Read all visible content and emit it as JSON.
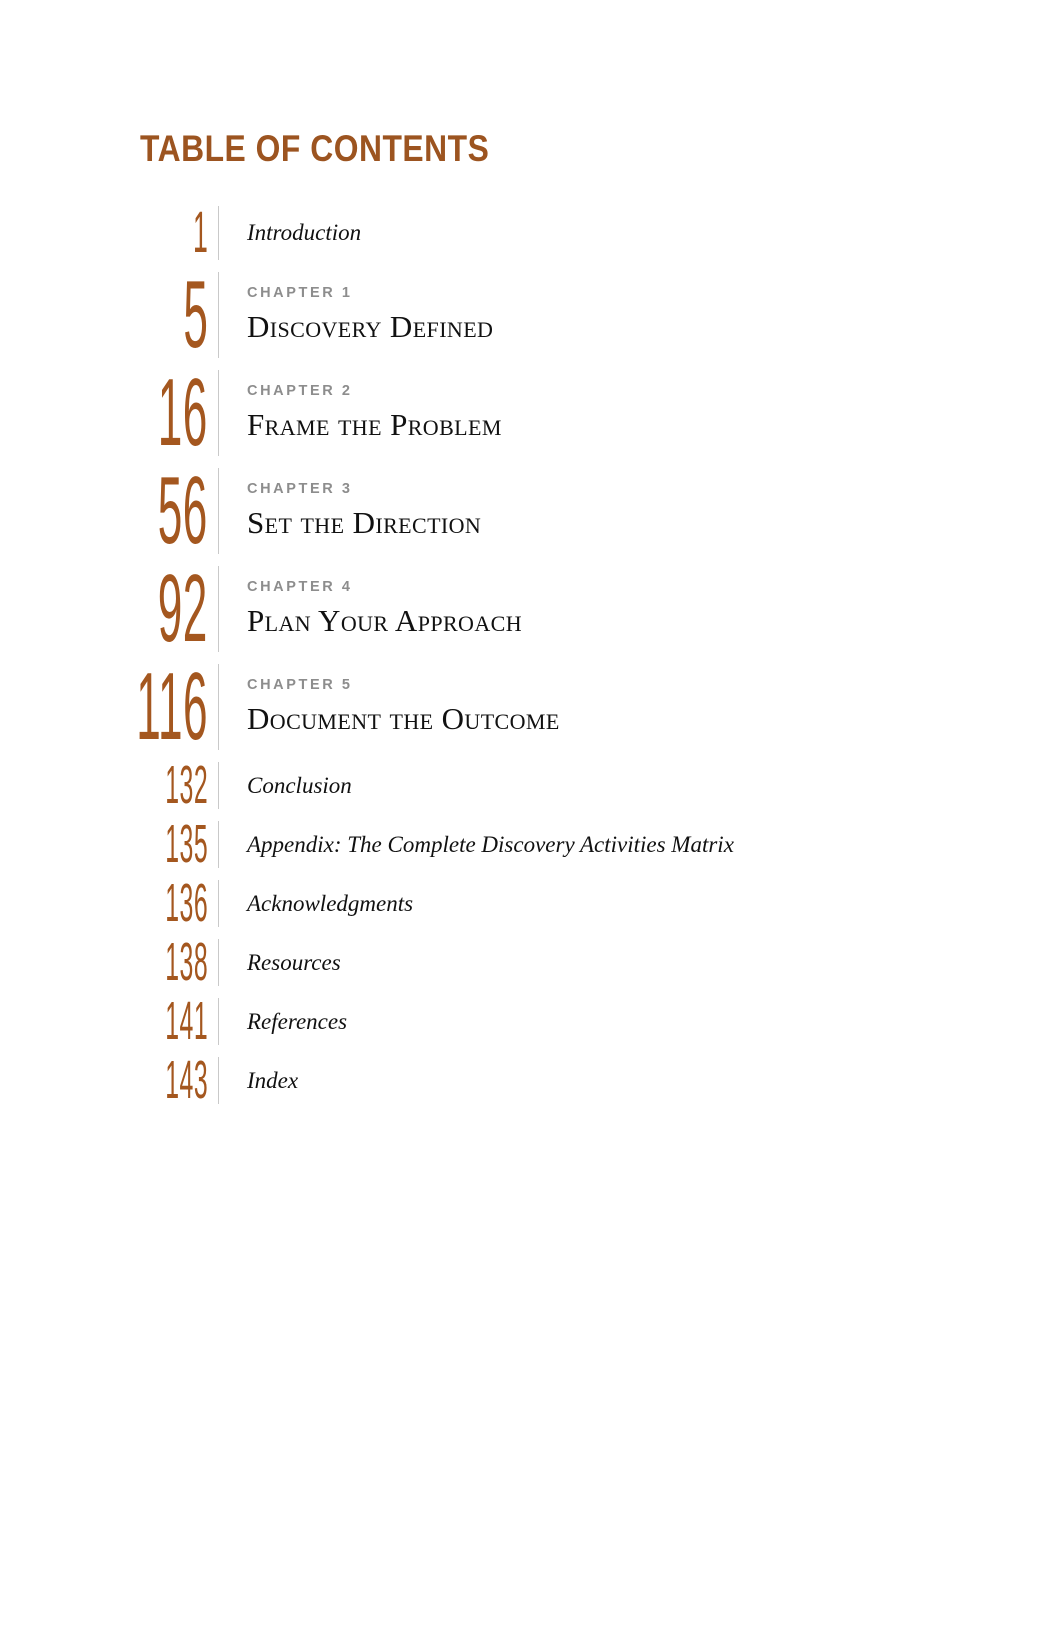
{
  "page": {
    "title": "TABLE OF CONTENTS",
    "accent_color": "#9c5420",
    "number_color": "#a4571f",
    "eyebrow_color": "#8d8d8d",
    "rule_color": "#c9c9c9",
    "background": "#ffffff"
  },
  "entries": [
    {
      "kind": "plain",
      "page_number": "1",
      "title": "Introduction"
    },
    {
      "kind": "chapter",
      "page_number": "5",
      "eyebrow": "CHAPTER 1",
      "title": "Discovery Defined"
    },
    {
      "kind": "chapter",
      "page_number": "16",
      "eyebrow": "CHAPTER 2",
      "title": "Frame the Problem"
    },
    {
      "kind": "chapter",
      "page_number": "56",
      "eyebrow": "CHAPTER 3",
      "title": "Set the Direction"
    },
    {
      "kind": "chapter",
      "page_number": "92",
      "eyebrow": "CHAPTER 4",
      "title": "Plan Your Approach"
    },
    {
      "kind": "chapter",
      "page_number": "116",
      "eyebrow": "CHAPTER 5",
      "title": "Document the Outcome"
    },
    {
      "kind": "plain",
      "page_number": "132",
      "title": "Conclusion"
    },
    {
      "kind": "plain",
      "page_number": "135",
      "title": "Appendix: The Complete Discovery Activities Matrix"
    },
    {
      "kind": "plain",
      "page_number": "136",
      "title": "Acknowledgments"
    },
    {
      "kind": "plain",
      "page_number": "138",
      "title": "Resources"
    },
    {
      "kind": "plain",
      "page_number": "141",
      "title": "References"
    },
    {
      "kind": "plain",
      "page_number": "143",
      "title": "Index"
    }
  ]
}
